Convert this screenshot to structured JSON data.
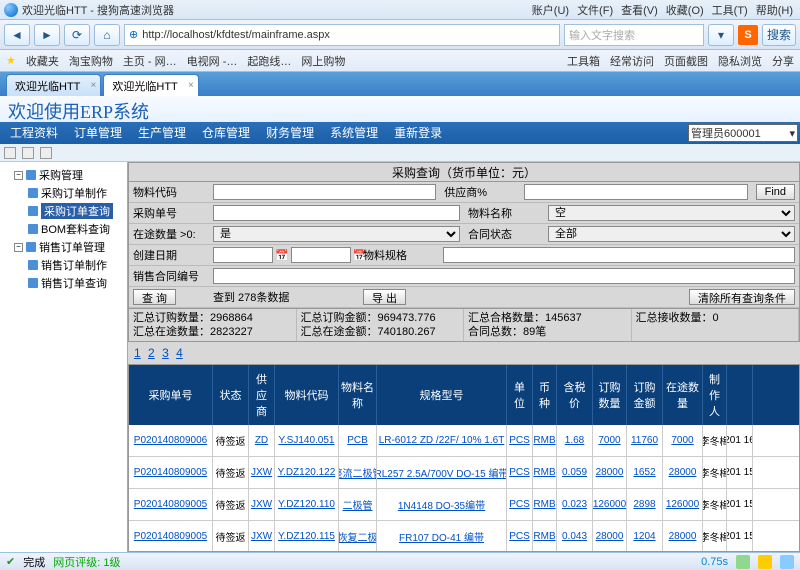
{
  "browser": {
    "window_title": "欢迎光临HTT - 搜狗高速浏览器",
    "menus": [
      "账户(U)",
      "文件(F)",
      "查看(V)",
      "收藏(O)",
      "工具(T)",
      "帮助(H)"
    ],
    "url": "http://localhost/kfdtest/mainframe.aspx",
    "search_placeholder": "输入文字搜索",
    "search_btn": "搜索",
    "bookmarks_label": "收藏夹",
    "bookmarks": [
      "淘宝购物",
      "主页 - 网…",
      "电视网 -…",
      "起跑线…",
      "网上购物"
    ],
    "tool_links": [
      "工具箱",
      "经常访问",
      "页面截图",
      "隐私浏览",
      "分享"
    ],
    "tabs": [
      {
        "label": "欢迎光临HTT",
        "active": false
      },
      {
        "label": "欢迎光临HTT",
        "active": true
      }
    ]
  },
  "erp": {
    "title": "欢迎使用ERP系统",
    "menu": [
      "工程资料",
      "订单管理",
      "生产管理",
      "仓库管理",
      "财务管理",
      "系统管理",
      "重新登录"
    ],
    "user_label": "管理员600001",
    "tree": {
      "n1": {
        "label": "采购管理",
        "children": [
          {
            "label": "采购订单制作"
          },
          {
            "label": "采购订单查询",
            "selected": true
          },
          {
            "label": "BOM套料查询"
          }
        ]
      },
      "n2": {
        "label": "销售订单管理",
        "children": [
          {
            "label": "销售订单制作"
          },
          {
            "label": "销售订单查询"
          }
        ]
      }
    }
  },
  "query": {
    "title": "采购查询（货币单位：元）",
    "labels": {
      "material_code": "物料代码",
      "supplier": "供应商%",
      "po_no": "采购单号",
      "material_name": "物料名称",
      "in_transit_qty": "在途数量 >0:",
      "contract_status": "合同状态",
      "create_date": "创建日期",
      "material_spec": "物料规格",
      "sales_contract_no": "销售合同编号"
    },
    "options": {
      "in_transit": "是",
      "material_name": "空",
      "contract_status": "全部"
    },
    "find_btn": "Find",
    "search_btn": "查 询",
    "found_text": "查到 278条数据",
    "export_btn": "导 出",
    "clear_btn": "清除所有查询条件",
    "summary": {
      "total_order_qty_lbl": "汇总订购数量：",
      "total_order_qty": "2968864",
      "total_transit_qty_lbl": "汇总在途数量：",
      "total_transit_qty": "2823227",
      "total_order_amt_lbl": "汇总订购金额：",
      "total_order_amt": "969473.776",
      "total_transit_amt_lbl": "汇总在途金额：",
      "total_transit_amt": "740180.267",
      "total_pass_qty_lbl": "汇总合格数量：",
      "total_pass_qty": "145637",
      "contract_total_lbl": "合同总数：",
      "contract_total": "89笔",
      "total_recv_qty_lbl": "汇总接收数量：",
      "total_recv_qty": "0"
    }
  },
  "pager": [
    "1",
    "2",
    "3",
    "4"
  ],
  "columns": [
    "采购单号",
    "状态",
    "供应商",
    "物料代码",
    "物料名称",
    "规格型号",
    "单位",
    "币种",
    "含税价",
    "订购数量",
    "订购金额",
    "在途数量",
    "制作人",
    ""
  ],
  "rows": [
    {
      "po": "P020140809006",
      "status": "待签返",
      "sup": "ZD",
      "code": "Y.SJ140.051",
      "name": "PCB",
      "spec": "LR-6012 ZD /22F/ 10% 1.6T",
      "unit": "PCS",
      "cur": "RMB",
      "price": "1.68",
      "qty": "7000",
      "amt": "11760",
      "transit": "7000",
      "maker": "李冬梅",
      "date": "201\n16"
    },
    {
      "po": "P020140809005",
      "status": "待签返",
      "sup": "JXW",
      "code": "Y.DZ120.122",
      "name": "整流二极管",
      "spec": "RL257 2.5A/700V DO-15 编带",
      "unit": "PCS",
      "cur": "RMB",
      "price": "0.059",
      "qty": "28000",
      "amt": "1652",
      "transit": "28000",
      "maker": "李冬梅",
      "date": "201\n15"
    },
    {
      "po": "P020140809005",
      "status": "待签返",
      "sup": "JXW",
      "code": "Y.DZ120.110",
      "name": "二极管",
      "spec": "1N4148 DO-35编带",
      "unit": "PCS",
      "cur": "RMB",
      "price": "0.023",
      "qty": "126000",
      "amt": "2898",
      "transit": "126000",
      "maker": "李冬梅",
      "date": "201\n15"
    },
    {
      "po": "P020140809005",
      "status": "待签返",
      "sup": "JXW",
      "code": "Y.DZ120.115",
      "name": "快恢复二极管",
      "spec": "FR107 DO-41 编带",
      "unit": "PCS",
      "cur": "RMB",
      "price": "0.043",
      "qty": "28000",
      "amt": "1204",
      "transit": "28000",
      "maker": "李冬梅",
      "date": "201\n15"
    }
  ],
  "status": {
    "done": "完成",
    "rating": "网页评级: 1级",
    "time": "0.75s"
  }
}
